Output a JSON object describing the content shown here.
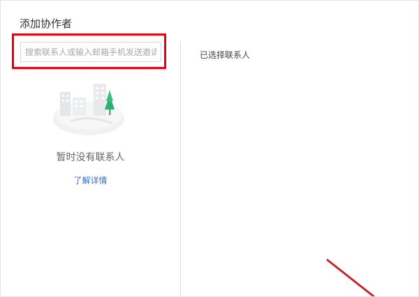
{
  "dialog": {
    "title": "添加协作者"
  },
  "search": {
    "placeholder": "搜索联系人或输入邮箱手机发送邀请",
    "value": ""
  },
  "contacts": {
    "empty_text": "暂时没有联系人",
    "learn_more_label": "了解详情"
  },
  "selected": {
    "title": "已选择联系人"
  },
  "colors": {
    "highlight_box": "#e60012",
    "link": "#3a6fc9",
    "annotation_arrow": "#c0272d"
  }
}
